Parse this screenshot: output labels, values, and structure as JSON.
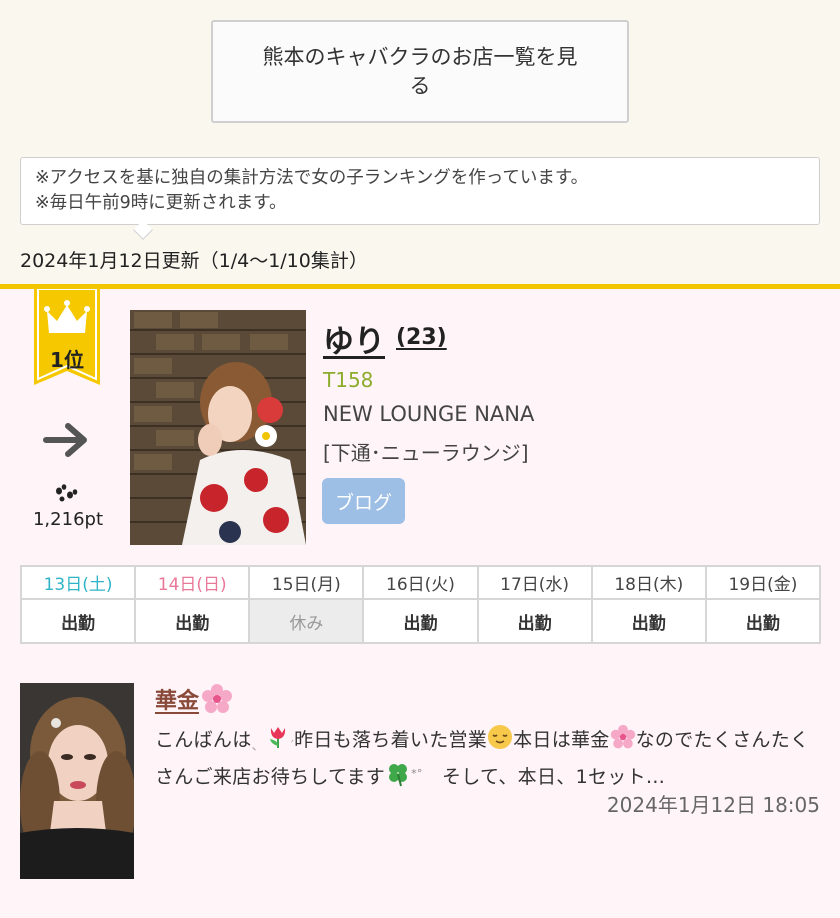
{
  "top": {
    "shop_list_button": "熊本のキャバクラのお店一覧を見る",
    "notice_line1": "※アクセスを基に独自の集計方法で女の子ランキングを作っています。",
    "notice_line2": "※毎日午前9時に更新されます。",
    "update_date": "2024年1月12日更新（1/4〜1/10集計）"
  },
  "ranking": {
    "rank_label": "1位",
    "trend_icon": "arrow-right-icon",
    "points": "1,216pt",
    "name": "ゆり",
    "age": "(23)",
    "height": "T158",
    "shop": "NEW LOUNGE NANA",
    "area": "[下通･ニューラウンジ]",
    "blog_button": "ブログ"
  },
  "schedule": {
    "days": [
      "13日(土)",
      "14日(日)",
      "15日(月)",
      "16日(火)",
      "17日(水)",
      "18日(木)",
      "19日(金)"
    ],
    "statuses": [
      "出勤",
      "出勤",
      "休み",
      "出勤",
      "出勤",
      "出勤",
      "出勤"
    ]
  },
  "blog": {
    "title": "華金",
    "excerpt_part1": "こんばんは",
    "excerpt_part2": "昨日も落ち着いた営業",
    "excerpt_part3": "本日は華金",
    "excerpt_part4": "なのでたくさんたくさんご来店お待ちしてます",
    "excerpt_part5": "　そして、本日、1セット…",
    "date": "2024年1月12日 18:05"
  },
  "colors": {
    "accent_gold": "#f1c500",
    "saturday": "#2fb3c6",
    "sunday": "#e9779a",
    "height_green": "#8cac2c",
    "blog_button": "#9dbfe6"
  }
}
